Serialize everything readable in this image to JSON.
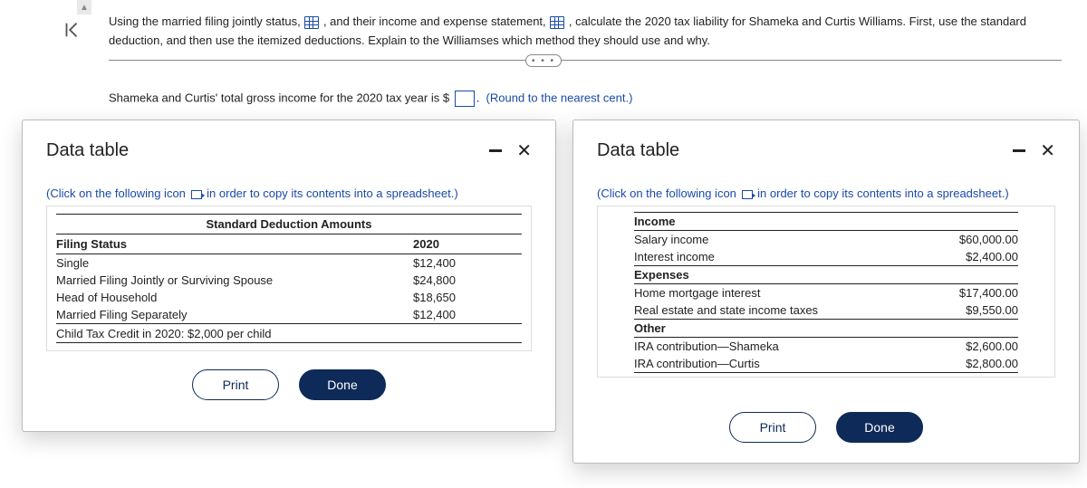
{
  "question": {
    "seg1": "Using the married filing jointly status,",
    "seg2": ", and their income and expense statement,",
    "seg3": ", calculate the 2020 tax liability for Shameka and Curtis Williams. First, use the standard deduction, and then use the itemized deductions. Explain to the Williamses which method they should use and why."
  },
  "prompt": {
    "line": "Shameka and Curtis' total gross income for the 2020 tax year is $",
    "hint": "(Round to the nearest cent.)"
  },
  "ellipsis": "•  •  •",
  "modalLeft": {
    "title": "Data table",
    "instruct_a": "(Click on the following icon",
    "instruct_b": "in order to copy its contents into a spreadsheet.)",
    "section_title": "Standard Deduction Amounts",
    "col_status": "Filing Status",
    "col_year": "2020",
    "rows": [
      {
        "label": "Single",
        "amt": "$12,400"
      },
      {
        "label": "Married Filing Jointly or Surviving Spouse",
        "amt": "$24,800"
      },
      {
        "label": "Head of Household",
        "amt": "$18,650"
      },
      {
        "label": "Married Filing Separately",
        "amt": "$12,400"
      }
    ],
    "footnote": "Child Tax Credit in 2020: $2,000 per child",
    "print": "Print",
    "done": "Done"
  },
  "modalRight": {
    "title": "Data table",
    "instruct_a": "(Click on the following icon",
    "instruct_b": "in order to copy its contents into a spreadsheet.)",
    "groups": {
      "income": {
        "head": "Income",
        "items": [
          {
            "label": "Salary income",
            "amt": "$60,000.00"
          },
          {
            "label": "Interest income",
            "amt": "$2,400.00"
          }
        ]
      },
      "expenses": {
        "head": "Expenses",
        "items": [
          {
            "label": "Home mortgage interest",
            "amt": "$17,400.00"
          },
          {
            "label": "Real estate and state income taxes",
            "amt": "$9,550.00"
          }
        ]
      },
      "other": {
        "head": "Other",
        "items": [
          {
            "label": "IRA contribution—Shameka",
            "amt": "$2,600.00"
          },
          {
            "label": "IRA contribution—Curtis",
            "amt": "$2,800.00"
          }
        ]
      }
    },
    "print": "Print",
    "done": "Done"
  }
}
